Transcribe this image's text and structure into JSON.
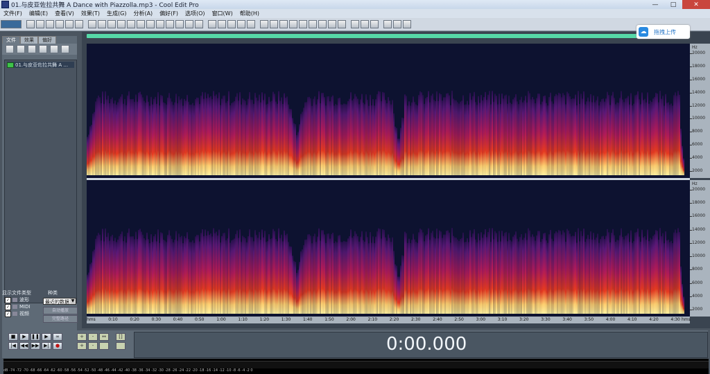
{
  "window": {
    "title": "01.与皮亚佐拉共舞 A Dance with Piazzolla.mp3 - Cool Edit Pro",
    "minimize": "—",
    "maximize": "□",
    "close": "✕"
  },
  "menu": [
    "文件(F)",
    "编辑(E)",
    "查看(V)",
    "效果(T)",
    "生成(G)",
    "分析(A)",
    "偏好(F)",
    "选项(O)",
    "窗口(W)",
    "帮助(H)"
  ],
  "left_panel": {
    "tabs": [
      "文件",
      "效果",
      "偏好"
    ],
    "files": [
      "01.与皮亚佐拉共舞 A ..."
    ],
    "type_header": "显示文件类型",
    "sort_header": "种类",
    "types": [
      {
        "label": "波形",
        "checked": true
      },
      {
        "label": "MIDI",
        "checked": true
      },
      {
        "label": "视频",
        "checked": true
      }
    ],
    "sort_value": "最近的数据",
    "sort_arrow": "▼",
    "btn_auto": "自动播放",
    "btn_full": "完整路径"
  },
  "cloud_upload": {
    "icon": "cloud-icon",
    "label": "拖拽上传"
  },
  "hz_axis": {
    "unit": "Hz",
    "ticks": [
      "20000",
      "18000",
      "16000",
      "14000",
      "12000",
      "10000",
      "8000",
      "6000",
      "4000",
      "2000"
    ]
  },
  "time_axis": {
    "ticks": [
      "hms",
      "0:10",
      "0:20",
      "0:30",
      "0:40",
      "0:50",
      "1:00",
      "1:10",
      "1:20",
      "1:30",
      "1:40",
      "1:50",
      "2:00",
      "2:10",
      "2:20",
      "2:30",
      "2:40",
      "2:50",
      "3:00",
      "3:10",
      "3:20",
      "3:30",
      "3:40",
      "3:50",
      "4:00",
      "4:10",
      "4:20",
      "4:30",
      "hms"
    ]
  },
  "transport": {
    "stop": "■",
    "play": "▶",
    "pause": "❚❚",
    "play_to_end": "▶",
    "loop": "∞",
    "to_start": "|◀",
    "rewind": "◀◀",
    "ffwd": "▶▶",
    "to_end": "▶|",
    "record": "●",
    "time": "0:00.000"
  },
  "zoom": {
    "zoom_in_h": "+",
    "zoom_out_h": "-",
    "zoom_full": "↔",
    "zoom_sel": "[]",
    "zoom_in_v": "+",
    "zoom_out_v": "-"
  },
  "level_meter": {
    "scale": "dB -74 -72 -70 -68 -66 -64 -62 -60 -58 -56 -54 -52 -50 -48 -46 -44 -42 -40 -38 -36 -34 -32 -30 -28 -26 -24 -22 -20 -18 -16 -14 -12 -10 -8 -6 -4 -2 0"
  },
  "colors": {
    "accent": "#56d8a8",
    "spectrum_low": "#ffd070",
    "spectrum_high": "#5a1878",
    "background": "#0d1230"
  }
}
